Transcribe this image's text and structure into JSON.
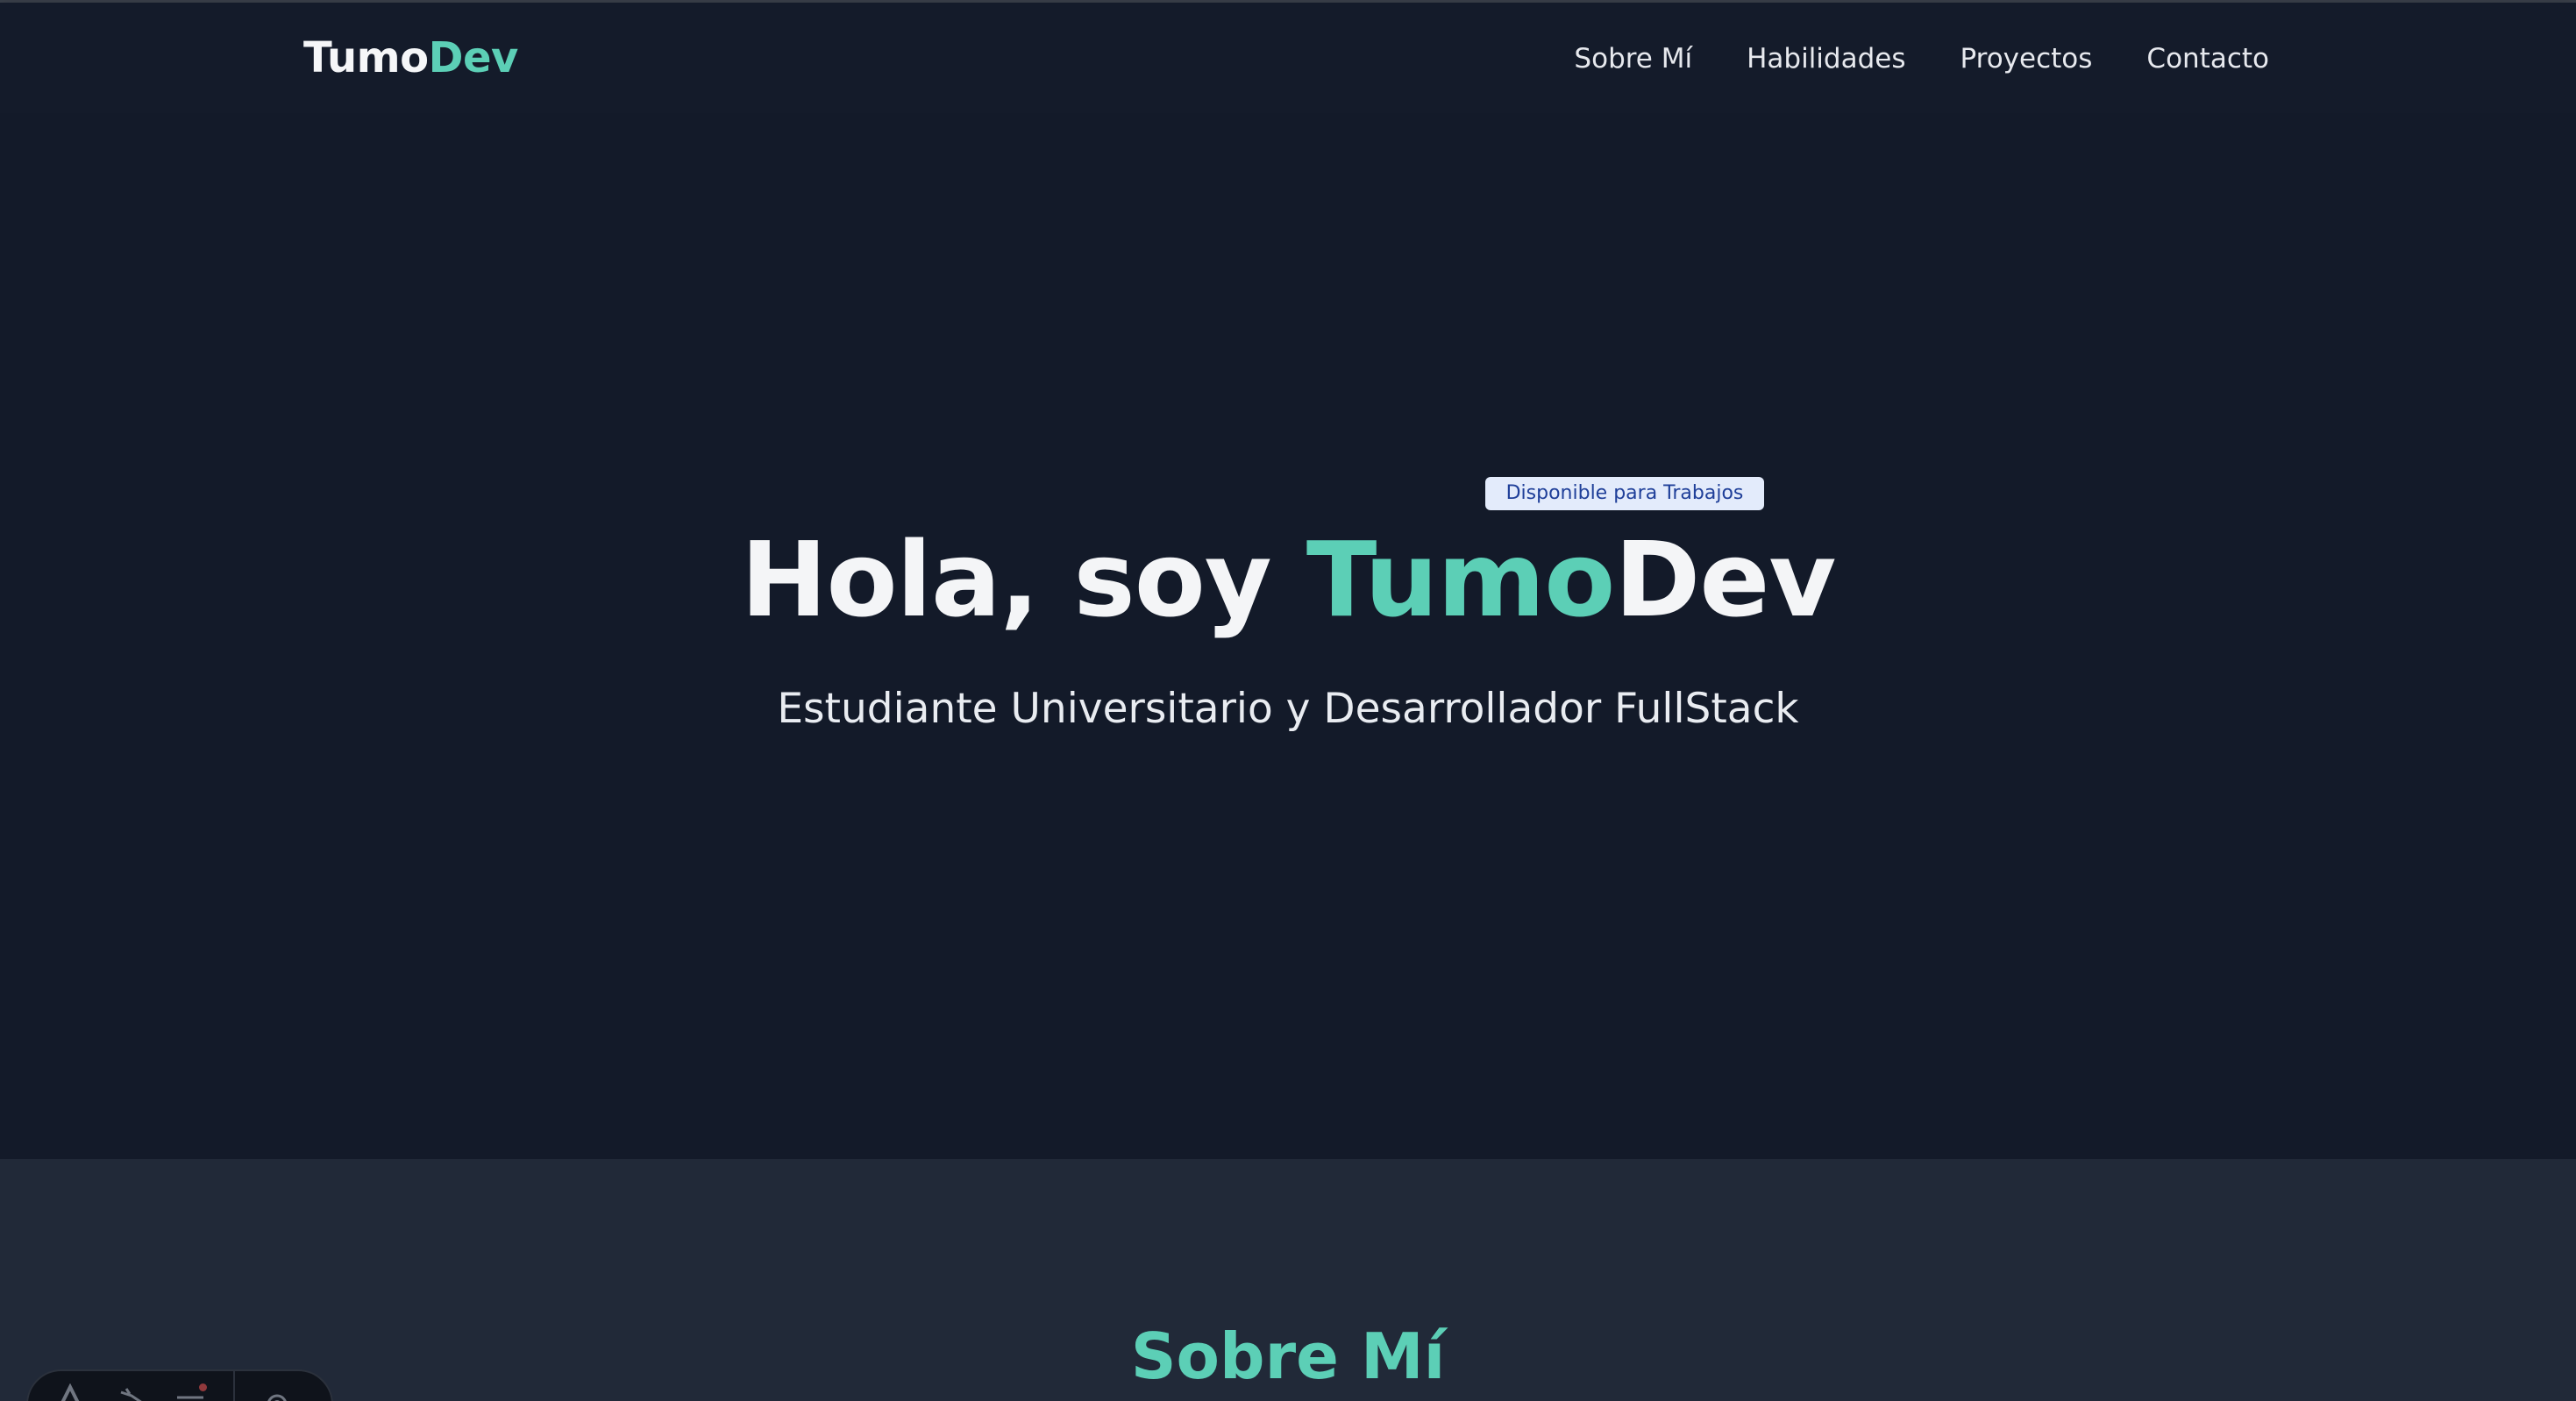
{
  "navbar": {
    "brand_part1": "Tumo",
    "brand_part2": "Dev",
    "links": [
      "Sobre Mí",
      "Habilidades",
      "Proyectos",
      "Contacto"
    ]
  },
  "hero": {
    "badge": "Disponible para Trabajos",
    "title_prefix": "Hola, soy ",
    "title_accent": "Tumo",
    "title_suffix": "Dev",
    "subtitle": "Estudiante Universitario y Desarrollador FullStack"
  },
  "about": {
    "title": "Sobre Mí"
  },
  "dev_toolbar": {
    "icons": [
      "inspect-icon",
      "audit-icon",
      "settings-menu-icon",
      "gear-icon"
    ]
  },
  "colors": {
    "accent": "#5ccfb6",
    "hero_background": "#131a29",
    "section_background": "#212938",
    "badge_background": "#e3ebfb",
    "badge_text": "#1f3f99"
  }
}
